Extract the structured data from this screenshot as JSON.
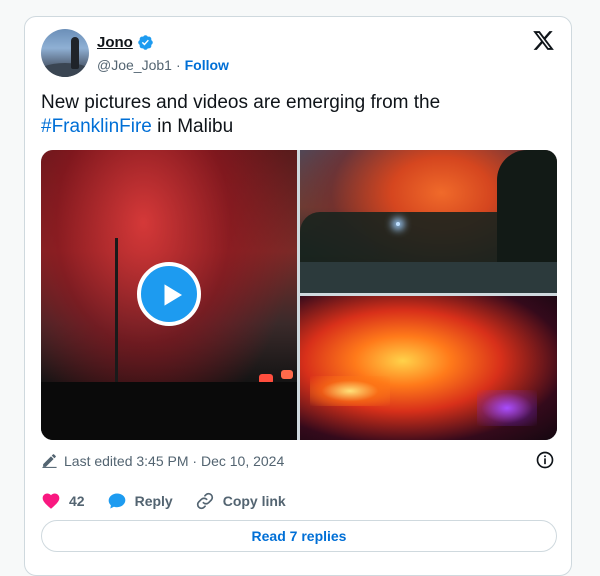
{
  "author": {
    "display_name": "Jono",
    "handle": "@Joe_Job1",
    "separator": "·",
    "follow_label": "Follow"
  },
  "tweet": {
    "text_before": "New pictures and videos are emerging from the ",
    "hashtag": "#FranklinFire",
    "text_after": " in Malibu"
  },
  "media": {
    "items": [
      "video",
      "image",
      "image"
    ]
  },
  "meta": {
    "edited_label": "Last edited 3:45 PM · Dec 10, 2024"
  },
  "actions": {
    "like_count": "42",
    "reply_label": "Reply",
    "copy_link_label": "Copy link"
  },
  "footer": {
    "read_replies_label": "Read 7 replies"
  },
  "icons": {
    "verified": "verified-badge-icon",
    "x_logo": "x-logo-icon",
    "play": "play-icon",
    "pencil": "pencil-icon",
    "info": "info-icon",
    "heart": "heart-icon",
    "reply": "speech-bubble-icon",
    "link": "link-icon"
  },
  "colors": {
    "accent": "#006fd6",
    "verified": "#1d9bf0",
    "heart": "#f91880",
    "text": "#0f1419",
    "secondary": "#536471",
    "border": "#cfd9de"
  }
}
